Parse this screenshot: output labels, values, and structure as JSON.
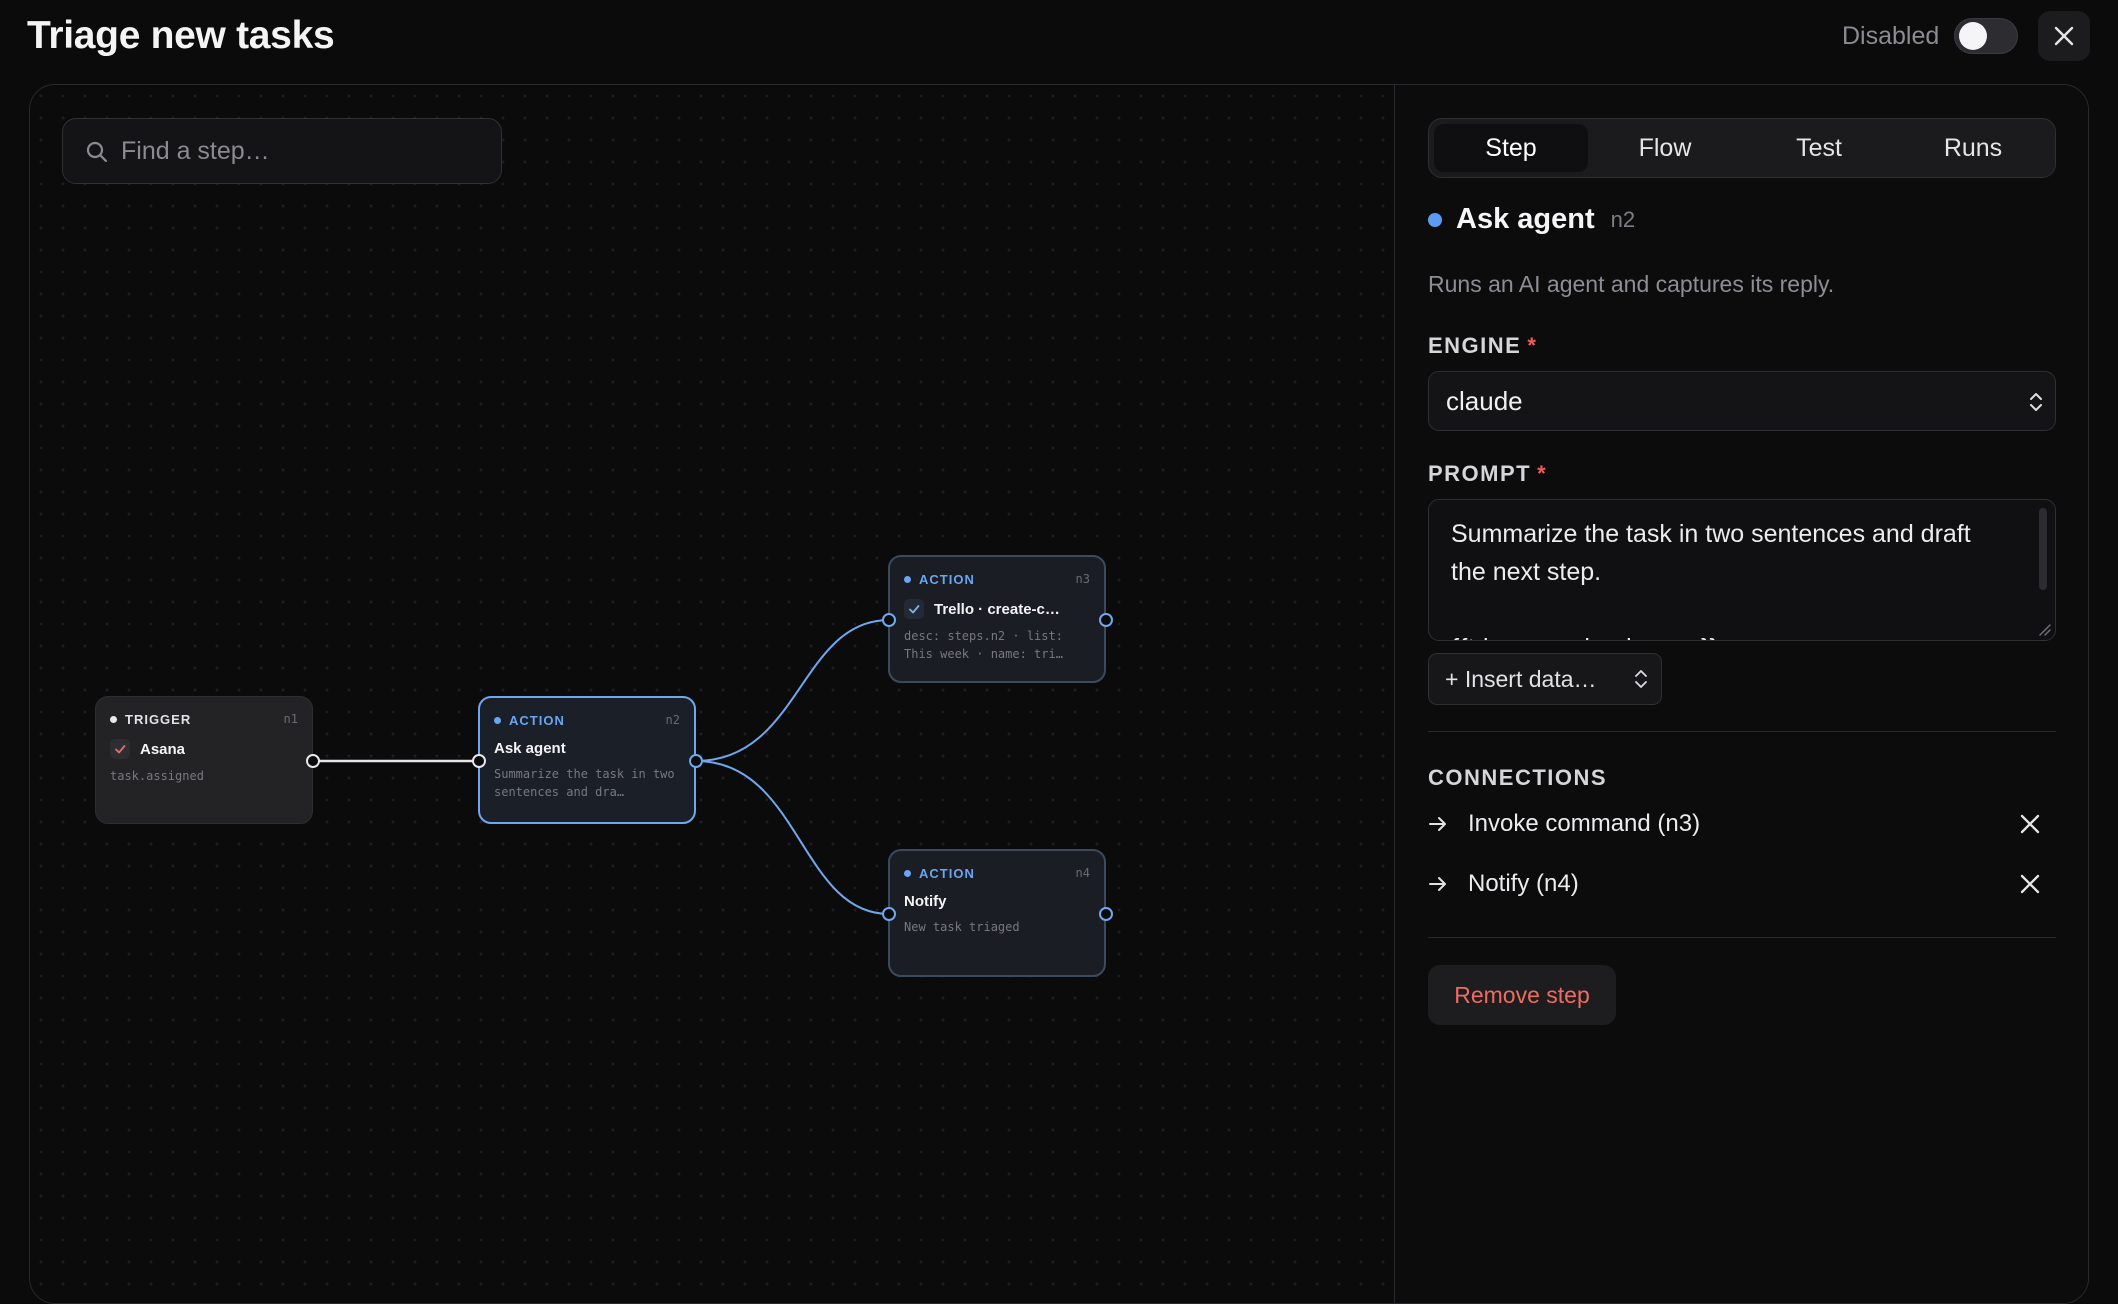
{
  "header": {
    "title": "Triage new tasks",
    "status_label": "Disabled",
    "toggle_enabled": false
  },
  "canvas": {
    "search": {
      "placeholder": "Find a step…",
      "value": ""
    },
    "nodes": [
      {
        "id": "n1",
        "kind": "TRIGGER",
        "title": "Asana",
        "desc": "task.assigned",
        "has_check": true
      },
      {
        "id": "n2",
        "kind": "ACTION",
        "title": "Ask agent",
        "desc": "Summarize the task in two sentences and dra…",
        "has_check": false,
        "selected": true
      },
      {
        "id": "n3",
        "kind": "ACTION",
        "title": "Trello · create-c…",
        "desc": "desc: steps.n2 · list: This week · name: tri…",
        "has_check": true
      },
      {
        "id": "n4",
        "kind": "ACTION",
        "title": "Notify",
        "desc": "New task triaged",
        "has_check": false
      }
    ],
    "edges": [
      {
        "from": "n1",
        "to": "n2"
      },
      {
        "from": "n2",
        "to": "n3"
      },
      {
        "from": "n2",
        "to": "n4"
      }
    ]
  },
  "panel": {
    "tabs": [
      {
        "label": "Step",
        "active": true
      },
      {
        "label": "Flow",
        "active": false
      },
      {
        "label": "Test",
        "active": false
      },
      {
        "label": "Runs",
        "active": false
      }
    ],
    "step": {
      "name": "Ask agent",
      "id": "n2",
      "description": "Runs an AI agent and captures its reply."
    },
    "engine": {
      "label": "ENGINE",
      "required_mark": "*",
      "value": "claude"
    },
    "prompt": {
      "label": "PROMPT",
      "required_mark": "*",
      "value": "Summarize the task in two sentences and draft the next step.\n\n{{trigger.payload.name}}"
    },
    "insert_label": "+ Insert data…",
    "connections": {
      "heading": "CONNECTIONS",
      "items": [
        {
          "label": "Invoke command (n3)"
        },
        {
          "label": "Notify (n4)"
        }
      ]
    },
    "remove_label": "Remove step"
  },
  "colors": {
    "accent": "#6fa8ef",
    "danger": "#ef6b62",
    "required": "#ef5b5b",
    "background": "#0b0b0c"
  },
  "icons": [
    "search-icon",
    "close-icon",
    "check-icon",
    "chevron-updown-icon",
    "arrow-right-icon",
    "resize-grip-icon"
  ]
}
